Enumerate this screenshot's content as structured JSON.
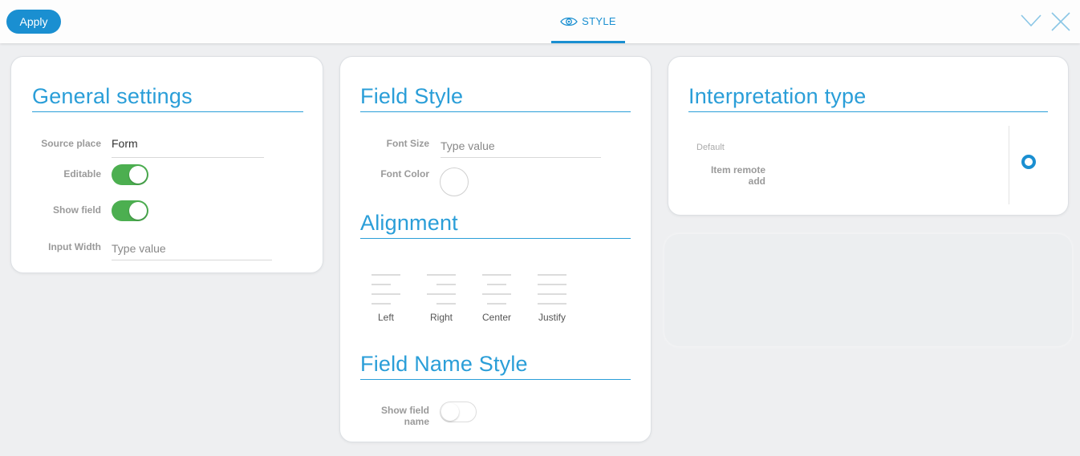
{
  "topbar": {
    "apply_label": "Apply",
    "active_tab": "STYLE"
  },
  "colors": {
    "accent": "#1a8fd1",
    "toggle_on": "#4caf50",
    "background": "#eeeff1"
  },
  "general": {
    "title": "General settings",
    "source_place_label": "Source place",
    "source_place_value": "Form",
    "editable_label": "Editable",
    "editable_on": true,
    "show_field_label": "Show field",
    "show_field_on": true,
    "input_width_label": "Input Width",
    "input_width_placeholder": "Type value"
  },
  "field_style": {
    "title": "Field Style",
    "font_size_label": "Font Size",
    "font_size_placeholder": "Type value",
    "font_color_label": "Font Color",
    "alignment_title": "Alignment",
    "alignments": [
      "Left",
      "Right",
      "Center",
      "Justify"
    ],
    "field_name_style_title": "Field Name Style",
    "show_field_name_label": "Show field name",
    "show_field_name_on": false
  },
  "interpretation": {
    "title": "Interpretation type",
    "default_label": "Default",
    "option_label": "Item remote add",
    "option_selected": true
  }
}
